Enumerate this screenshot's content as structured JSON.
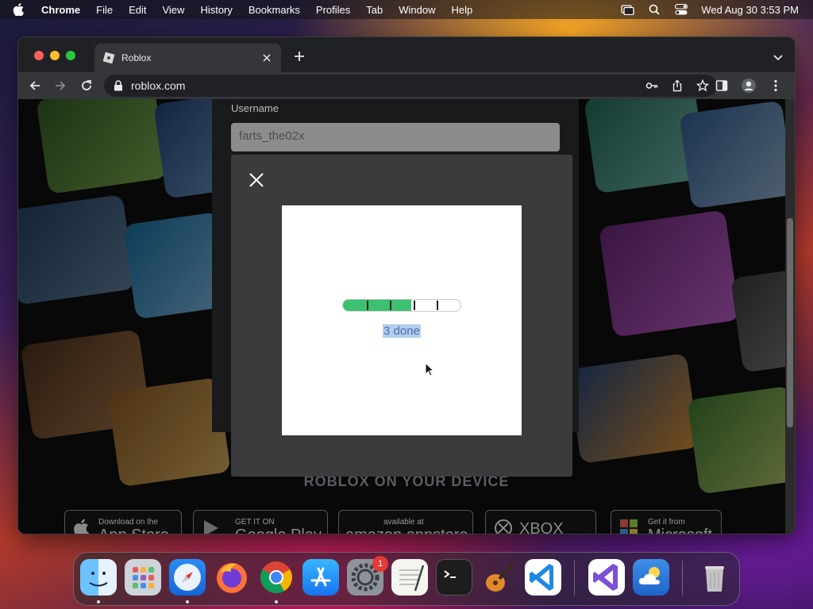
{
  "menubar": {
    "app_name": "Chrome",
    "items": [
      "File",
      "Edit",
      "View",
      "History",
      "Bookmarks",
      "Profiles",
      "Tab",
      "Window",
      "Help"
    ],
    "clock": "Wed Aug 30  3:53 PM"
  },
  "browser": {
    "tab_title": "Roblox",
    "url": "roblox.com"
  },
  "page": {
    "username_label": "Username",
    "username_value": "farts_the02x",
    "device_heading": "ROBLOX ON YOUR DEVICE",
    "badges": [
      {
        "small": "Download on the",
        "big": "App Store"
      },
      {
        "small": "GET IT ON",
        "big": "Google Play"
      },
      {
        "small": "available at",
        "big": "amazon appstore"
      },
      {
        "small": "",
        "big": "XBOX ONE"
      },
      {
        "small": "Get it from",
        "big": "Microsoft"
      }
    ]
  },
  "challenge": {
    "progress_text": "3 done",
    "progress_fraction": 0.58,
    "segments": 5
  },
  "dock": {
    "apps": [
      "Finder",
      "Launchpad",
      "Safari",
      "Firefox",
      "Chrome",
      "App Store",
      "System Settings",
      "TextEdit",
      "Terminal",
      "GarageBand",
      "Visual Studio Code",
      "Visual Studio",
      "Weather",
      "Trash"
    ],
    "settings_badge": "1"
  },
  "colors": {
    "progress_green": "#3cc072",
    "selection": "#b4cdee"
  }
}
